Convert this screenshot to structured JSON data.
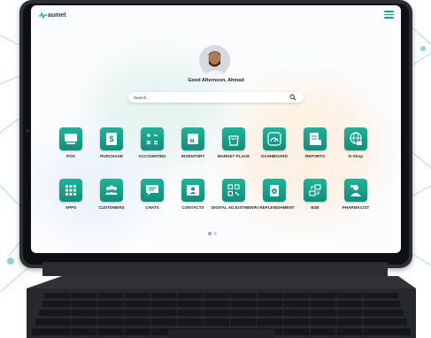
{
  "app": {
    "logo_text": "aumet"
  },
  "user": {
    "greeting": "Good Afternoon, Ahmad"
  },
  "search": {
    "placeholder": "Search.."
  },
  "apps_row1": [
    {
      "label": "POS",
      "icon": "pos-icon"
    },
    {
      "label": "PURCHASE",
      "icon": "invoice-icon"
    },
    {
      "label": "ACCOUNTING",
      "icon": "calculator-icon"
    },
    {
      "label": "INVENTORY",
      "icon": "box-icon"
    },
    {
      "label": "MARKET PLACE",
      "icon": "shopping-bag-icon"
    },
    {
      "label": "DASHBOARD",
      "icon": "gauge-icon"
    },
    {
      "label": "REPORTS",
      "icon": "report-icon"
    },
    {
      "label": "E-Shop",
      "icon": "globe-cart-icon"
    }
  ],
  "apps_row2": [
    {
      "label": "APPS",
      "icon": "grid-icon"
    },
    {
      "label": "CUSTOMERS",
      "icon": "users-icon"
    },
    {
      "label": "CHATS",
      "icon": "chat-icon"
    },
    {
      "label": "CONTACTS",
      "icon": "contact-card-icon"
    },
    {
      "label": "DIGITAL ADJUSTMENT",
      "icon": "qr-icon"
    },
    {
      "label": "AI REPLENISHMENT",
      "icon": "ai-icon"
    },
    {
      "label": "B2B",
      "icon": "b2b-icon"
    },
    {
      "label": "PHARMACIST",
      "icon": "pharmacist-icon"
    }
  ],
  "pagination": {
    "pages": 2,
    "current": 1
  },
  "colors": {
    "accent": "#14a08a",
    "text": "#2b2b2b"
  }
}
